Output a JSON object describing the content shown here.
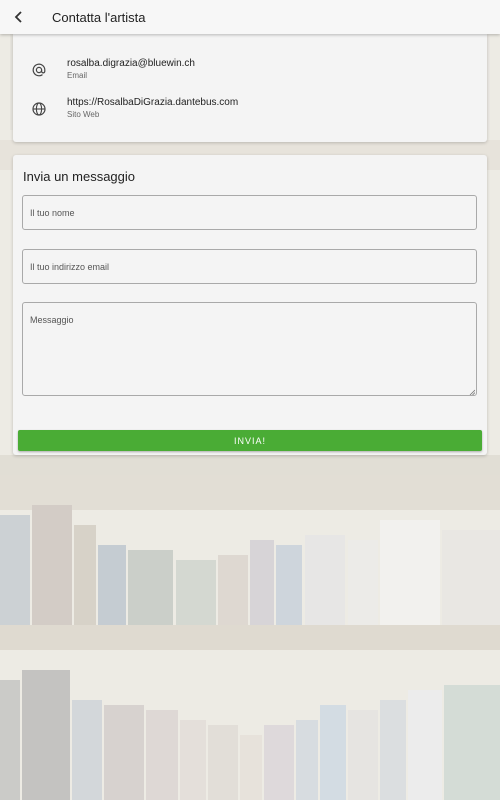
{
  "header": {
    "title": "Contatta l'artista"
  },
  "contact": [
    {
      "value": "rosalba.digrazia@bluewin.ch",
      "label": "Email",
      "icon": "at-sign-icon"
    },
    {
      "value": "https://RosalbaDiGrazia.dantebus.com",
      "label": "Sito Web",
      "icon": "globe-icon"
    }
  ],
  "form": {
    "title": "Invia un messaggio",
    "name_placeholder": "Il tuo nome",
    "email_placeholder": "Il tuo indirizzo email",
    "message_placeholder": "Messaggio",
    "send_label": "INVIA!"
  },
  "colors": {
    "accent": "#4aac35",
    "card": "#f4f4f4",
    "appbar": "#f7f7f7"
  }
}
